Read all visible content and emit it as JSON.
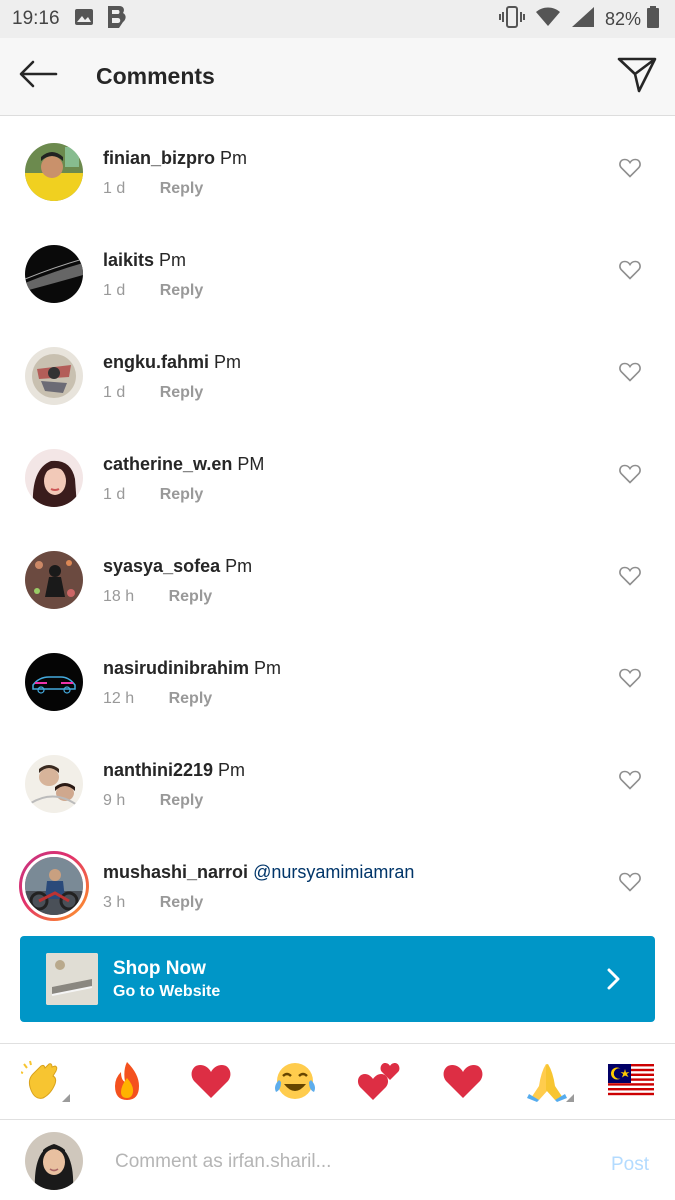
{
  "status_bar": {
    "time": "19:16",
    "battery": "82%",
    "icons": [
      "image-icon",
      "blogger-icon",
      "vibrate-icon",
      "wifi-icon",
      "signal-icon",
      "battery-icon"
    ]
  },
  "header": {
    "title": "Comments",
    "back_icon": "arrow-left-icon",
    "action_icon": "send-icon"
  },
  "comments": [
    {
      "username": "finian_bizpro",
      "text": "Pm",
      "time": "1 d",
      "reply": "Reply"
    },
    {
      "username": "laikits",
      "text": "Pm",
      "time": "1 d",
      "reply": "Reply"
    },
    {
      "username": "engku.fahmi",
      "text": "Pm",
      "time": "1 d",
      "reply": "Reply"
    },
    {
      "username": "catherine_w.en",
      "text": "PM",
      "time": "1 d",
      "reply": "Reply"
    },
    {
      "username": "syasya_sofea",
      "text": "Pm",
      "time": "18 h",
      "reply": "Reply"
    },
    {
      "username": "nasirudinibrahim",
      "text": "Pm",
      "time": "12 h",
      "reply": "Reply"
    },
    {
      "username": "nanthini2219",
      "text": "Pm",
      "time": "9 h",
      "reply": "Reply"
    },
    {
      "username": "mushashi_narroi",
      "text": "@nursyamimiamran",
      "time": "3 h",
      "reply": "Reply",
      "story_ring": true
    }
  ],
  "shop_banner": {
    "title": "Shop Now",
    "subtitle": "Go to Website",
    "color": "#0096c7"
  },
  "emoji_bar": [
    "👏",
    "🔥",
    "❤️",
    "😂",
    "💕",
    "❤️",
    "🙏",
    "🇲🇾"
  ],
  "comment_input": {
    "placeholder": "Comment as irfan.sharil...",
    "post_label": "Post"
  },
  "colors": {
    "text": "#262626",
    "meta": "#999999",
    "mention": "#003569",
    "post_disabled": "#b3dbff"
  }
}
